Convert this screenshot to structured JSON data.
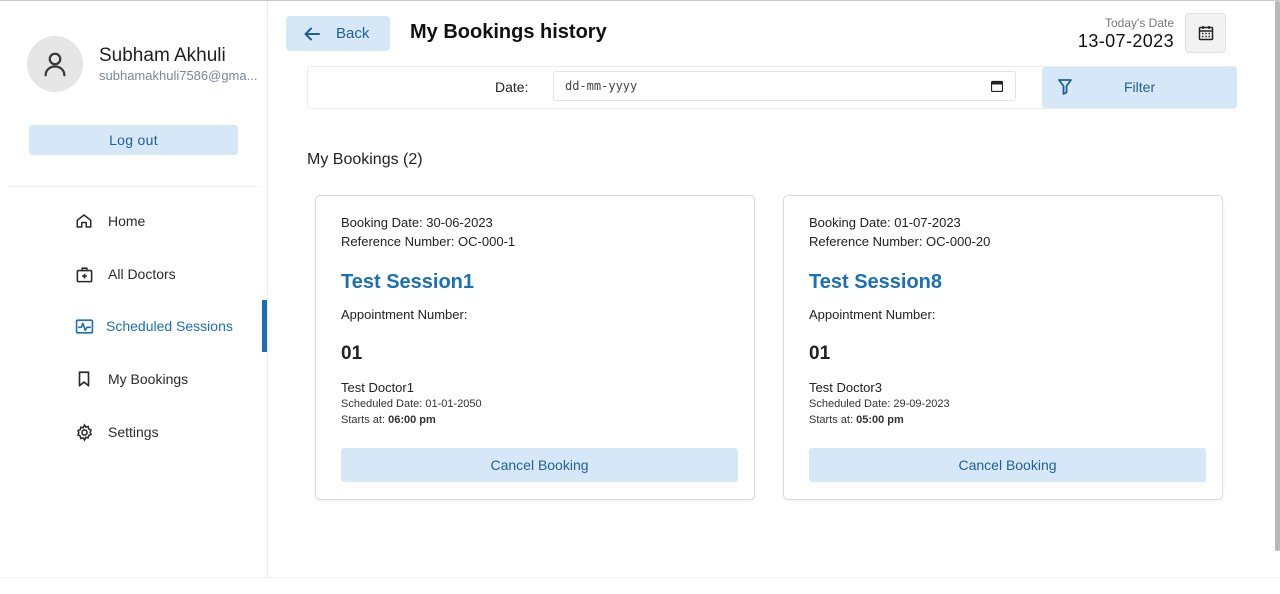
{
  "profile": {
    "name": "Subham Akhuli",
    "email": "subhamakhuli7586@gma..."
  },
  "sidebar": {
    "logout_label": "Log out",
    "items": [
      {
        "label": "Home",
        "icon": "home-icon",
        "active": false
      },
      {
        "label": "All Doctors",
        "icon": "medical-kit-icon",
        "active": false
      },
      {
        "label": "Scheduled Sessions",
        "icon": "pulse-icon",
        "active": true
      },
      {
        "label": "My Bookings",
        "icon": "bookmark-icon",
        "active": false
      },
      {
        "label": "Settings",
        "icon": "gear-icon",
        "active": false
      }
    ]
  },
  "header": {
    "back_label": "Back",
    "title": "My Bookings history",
    "today_label": "Today's Date",
    "today_value": "13-07-2023"
  },
  "filter": {
    "date_label": "Date:",
    "date_placeholder": "dd-mm-yyyy",
    "filter_label": "Filter"
  },
  "bookings": {
    "section_title": "My Bookings (2)",
    "items": [
      {
        "booking_date": "Booking Date: 30-06-2023",
        "reference": "Reference Number: OC-000-1",
        "session": "Test Session1",
        "appointment_label": "Appointment Number:",
        "appointment_number": "01",
        "doctor": "Test Doctor1",
        "scheduled_date": "Scheduled Date: 01-01-2050",
        "starts_label": "Starts at: ",
        "starts_time": "06:00 pm",
        "cancel_label": "Cancel Booking"
      },
      {
        "booking_date": "Booking Date: 01-07-2023",
        "reference": "Reference Number: OC-000-20",
        "session": "Test Session8",
        "appointment_label": "Appointment Number:",
        "appointment_number": "01",
        "doctor": "Test Doctor3",
        "scheduled_date": "Scheduled Date: 29-09-2023",
        "starts_label": "Starts at: ",
        "starts_time": "05:00 pm",
        "cancel_label": "Cancel Booking"
      }
    ]
  },
  "colors": {
    "accent": "#1a6fb5",
    "button_bg": "#d6e8f8",
    "button_text": "#1f5f96"
  }
}
